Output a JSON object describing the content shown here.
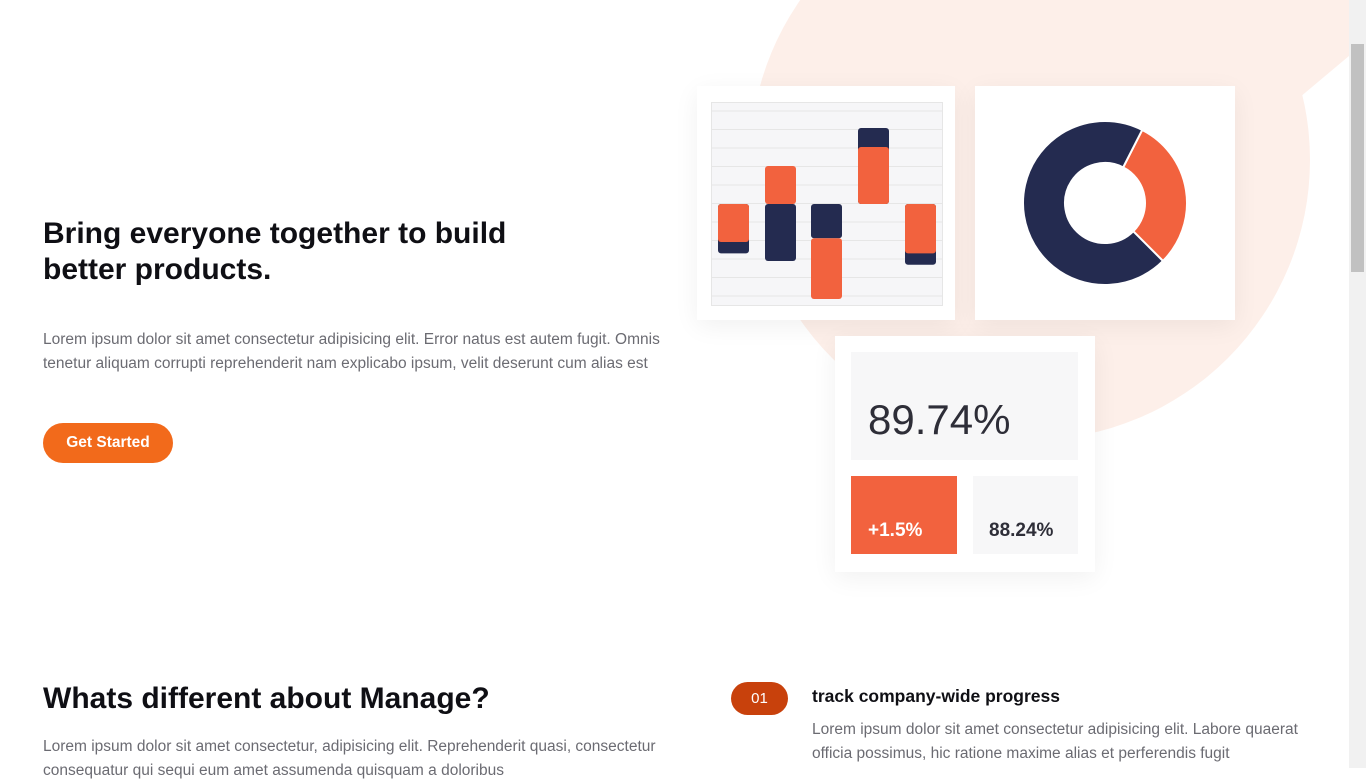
{
  "hero": {
    "title": "Bring everyone together to build better products.",
    "description": "Lorem ipsum dolor sit amet consectetur adipisicing elit. Error natus est autem fugit. Omnis tenetur aliquam corrupti reprehenderit nam explicabo ipsum, velit deserunt cum alias est",
    "cta_label": "Get Started"
  },
  "colors": {
    "accent": "#f26a1b",
    "chart_orange": "#f2623e",
    "chart_navy": "#242b50",
    "badge": "#c8410c",
    "bg_tint": "#fdefe9"
  },
  "chart_data": [
    {
      "type": "bar",
      "title": "",
      "series": [
        {
          "values_navy": [
            -1.3,
            0,
            -1.0,
            2.0,
            0,
            -1.6
          ]
        },
        {
          "values_orange": [
            -0.9,
            1.0,
            0.4,
            1.5,
            -0.2,
            -1.2
          ]
        }
      ],
      "bars": [
        {
          "navy": [
            0,
            -1.3
          ],
          "orange": [
            0,
            -1.0
          ]
        },
        {
          "navy": [
            0,
            -1.5
          ],
          "orange": [
            1.0,
            0
          ]
        },
        {
          "navy": [
            0,
            -0.9
          ],
          "orange": [
            -0.9,
            -2.5
          ]
        },
        {
          "navy": [
            2.0,
            0
          ],
          "orange": [
            1.5,
            0
          ]
        },
        {
          "navy": [
            0,
            -1.6
          ],
          "orange": [
            0,
            -1.3
          ]
        }
      ]
    },
    {
      "type": "pie",
      "title": "",
      "slices": [
        {
          "value": 30,
          "color": "#f2623e"
        },
        {
          "value": 70,
          "color": "#242b50"
        }
      ]
    }
  ],
  "stats": {
    "main_value": "89.74%",
    "change_value": "+1.5%",
    "secondary_value": "88.24%"
  },
  "section": {
    "title": "Whats different about Manage?",
    "description": "Lorem ipsum dolor sit amet consectetur, adipisicing elit. Reprehenderit quasi, consectetur consequatur qui sequi eum amet assumenda quisquam a doloribus"
  },
  "feature": {
    "number": "01",
    "title": "track company-wide progress",
    "description": "Lorem ipsum dolor sit amet consectetur adipisicing elit. Labore quaerat officia possimus, hic ratione maxime alias et perferendis fugit"
  }
}
